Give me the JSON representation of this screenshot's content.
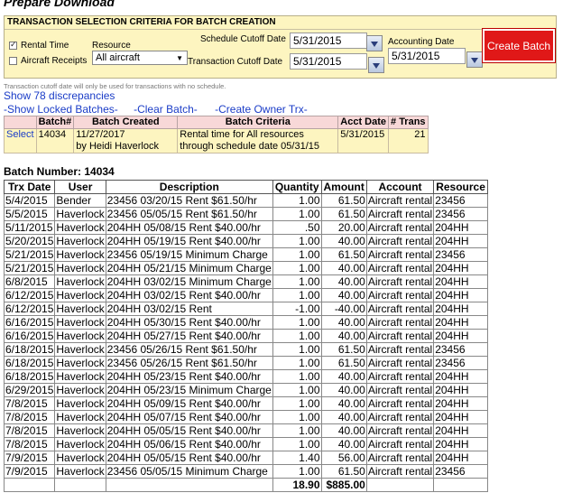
{
  "page_title": "Prepare Download",
  "criteria": {
    "heading": "TRANSACTION SELECTION CRITERIA FOR BATCH CREATION",
    "rental_time_label": "Rental Time",
    "aircraft_receipts_label": "Aircraft Receipts",
    "resource_label": "Resource",
    "resource_value": "All aircraft",
    "schedule_cutoff_label": "Schedule Cutoff Date",
    "schedule_cutoff_value": "5/31/2015",
    "transaction_cutoff_label": "Transaction Cutoff Date",
    "transaction_cutoff_value": "5/31/2015",
    "accounting_date_label": "Accounting Date",
    "accounting_date_value": "5/31/2015",
    "create_batch_label": "Create Batch"
  },
  "note": "Transaction cutoff date will only be used for transactions with no schedule.",
  "discrepancies_link": "Show 78 discrepancies",
  "links": {
    "locked": "-Show Locked Batches-",
    "clear": "-Clear Batch-",
    "owner": "-Create Owner Trx-"
  },
  "batch_table": {
    "headers": [
      "",
      "Batch#",
      "Batch Created",
      "Batch Criteria",
      "Acct Date",
      "# Trans"
    ],
    "row": {
      "select": "Select",
      "batch": "14034",
      "created_line1": "11/27/2017",
      "created_line2": "by Heidi Haverlock",
      "criteria_line1": "Rental time for All resources",
      "criteria_line2": "through schedule date 05/31/15",
      "acct_date": "5/31/2015",
      "trans": "21"
    }
  },
  "batch_number_label": "Batch Number: 14034",
  "trx_table": {
    "headers": [
      "Trx Date",
      "User",
      "Description",
      "Quantity",
      "Amount",
      "Account",
      "Resource"
    ],
    "rows": [
      [
        "5/4/2015",
        "Bender",
        "23456 03/20/15 Rent $61.50/hr",
        "1.00",
        "61.50",
        "Aircraft rental",
        "23456"
      ],
      [
        "5/5/2015",
        "Haverlock",
        "23456 05/05/15 Rent $61.50/hr",
        "1.00",
        "61.50",
        "Aircraft rental",
        "23456"
      ],
      [
        "5/11/2015",
        "Haverlock",
        "204HH 05/08/15 Rent $40.00/hr",
        ".50",
        "20.00",
        "Aircraft rental",
        "204HH"
      ],
      [
        "5/20/2015",
        "Haverlock",
        "204HH 05/19/15 Rent $40.00/hr",
        "1.00",
        "40.00",
        "Aircraft rental",
        "204HH"
      ],
      [
        "5/21/2015",
        "Haverlock",
        "23456 05/19/15 Minimum Charge",
        "1.00",
        "61.50",
        "Aircraft rental",
        "23456"
      ],
      [
        "5/21/2015",
        "Haverlock",
        "204HH 05/21/15 Minimum Charge",
        "1.00",
        "40.00",
        "Aircraft rental",
        "204HH"
      ],
      [
        "6/8/2015",
        "Haverlock",
        "204HH 03/02/15 Minimum Charge",
        "1.00",
        "40.00",
        "Aircraft rental",
        "204HH"
      ],
      [
        "6/12/2015",
        "Haverlock",
        "204HH 03/02/15 Rent $40.00/hr",
        "1.00",
        "40.00",
        "Aircraft rental",
        "204HH"
      ],
      [
        "6/12/2015",
        "Haverlock",
        "204HH 03/02/15 Rent",
        "-1.00",
        "-40.00",
        "Aircraft rental",
        "204HH"
      ],
      [
        "6/16/2015",
        "Haverlock",
        "204HH 05/30/15 Rent $40.00/hr",
        "1.00",
        "40.00",
        "Aircraft rental",
        "204HH"
      ],
      [
        "6/16/2015",
        "Haverlock",
        "204HH 05/27/15 Rent $40.00/hr",
        "1.00",
        "40.00",
        "Aircraft rental",
        "204HH"
      ],
      [
        "6/18/2015",
        "Haverlock",
        "23456 05/26/15 Rent $61.50/hr",
        "1.00",
        "61.50",
        "Aircraft rental",
        "23456"
      ],
      [
        "6/18/2015",
        "Haverlock",
        "23456 05/26/15 Rent $61.50/hr",
        "1.00",
        "61.50",
        "Aircraft rental",
        "23456"
      ],
      [
        "6/18/2015",
        "Haverlock",
        "204HH 05/23/15 Rent $40.00/hr",
        "1.00",
        "40.00",
        "Aircraft rental",
        "204HH"
      ],
      [
        "6/29/2015",
        "Haverlock",
        "204HH 05/23/15 Minimum Charge",
        "1.00",
        "40.00",
        "Aircraft rental",
        "204HH"
      ],
      [
        "7/8/2015",
        "Haverlock",
        "204HH 05/09/15 Rent $40.00/hr",
        "1.00",
        "40.00",
        "Aircraft rental",
        "204HH"
      ],
      [
        "7/8/2015",
        "Haverlock",
        "204HH 05/07/15 Rent $40.00/hr",
        "1.00",
        "40.00",
        "Aircraft rental",
        "204HH"
      ],
      [
        "7/8/2015",
        "Haverlock",
        "204HH 05/05/15 Rent $40.00/hr",
        "1.00",
        "40.00",
        "Aircraft rental",
        "204HH"
      ],
      [
        "7/8/2015",
        "Haverlock",
        "204HH 05/06/15 Rent $40.00/hr",
        "1.00",
        "40.00",
        "Aircraft rental",
        "204HH"
      ],
      [
        "7/9/2015",
        "Haverlock",
        "204HH 05/05/15 Rent $40.00/hr",
        "1.40",
        "56.00",
        "Aircraft rental",
        "204HH"
      ],
      [
        "7/9/2015",
        "Haverlock",
        "23456 05/05/15 Minimum Charge",
        "1.00",
        "61.50",
        "Aircraft rental",
        "23456"
      ]
    ],
    "total_quantity": "18.90",
    "total_amount": "$885.00"
  },
  "colors": {
    "criteria_bg": "#fdf5c0",
    "batch_header_bg": "#f8d8d8",
    "link": "#1a3cc7",
    "create_button": "#e01818"
  }
}
